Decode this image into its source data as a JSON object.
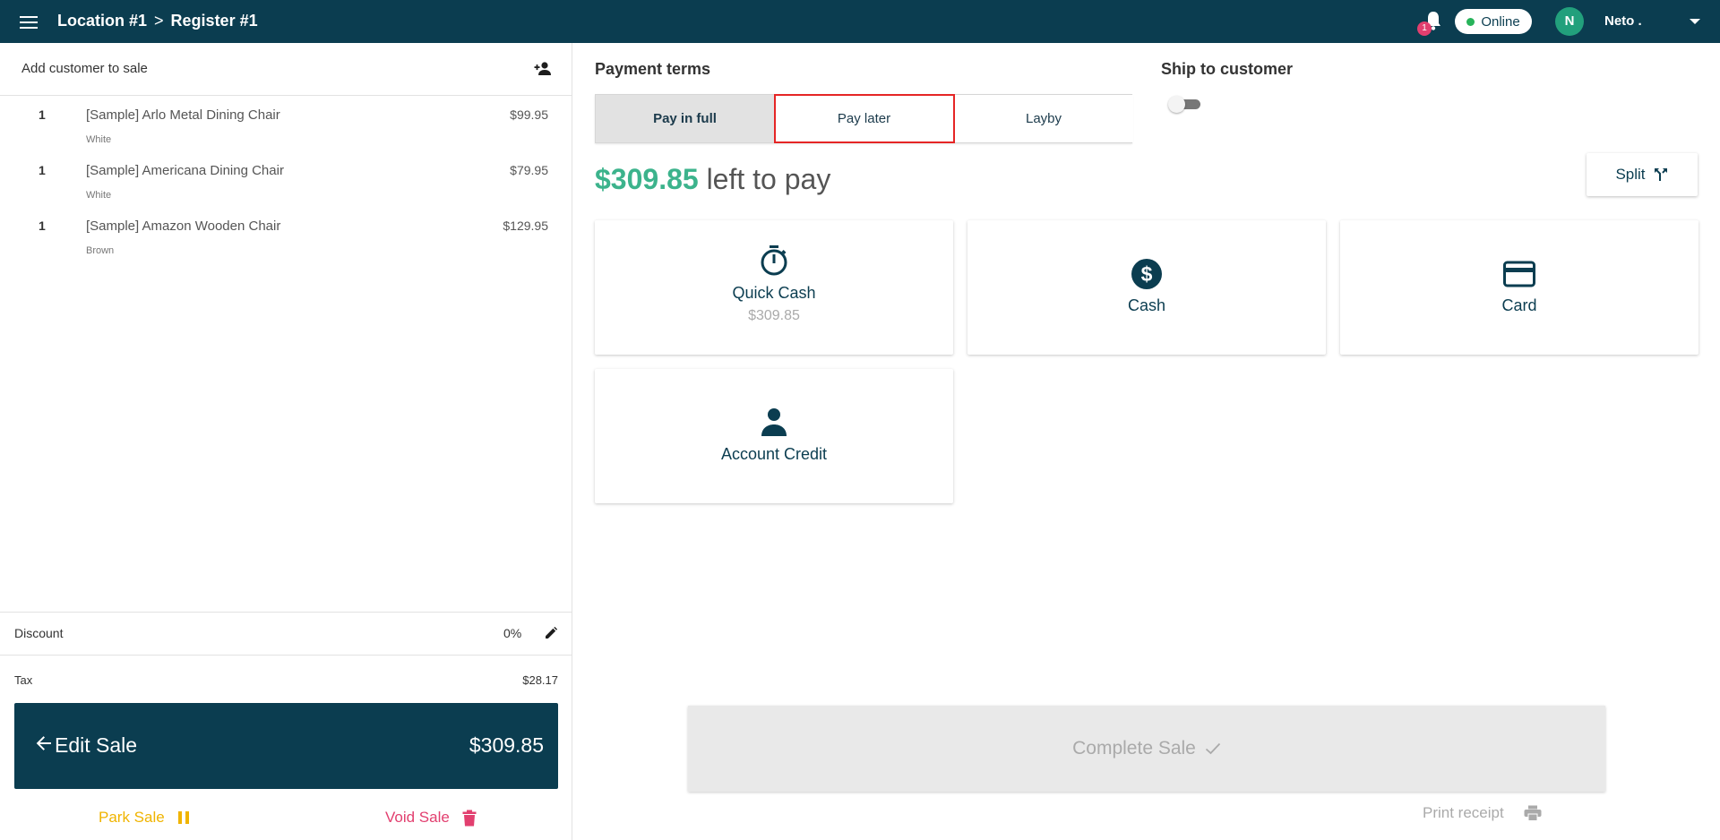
{
  "header": {
    "location": "Location #1",
    "separator": ">",
    "register": "Register #1",
    "notification_count": "1",
    "status": "Online",
    "user_initial": "N",
    "user_name": "Neto ."
  },
  "sidebar": {
    "add_customer_label": "Add customer to sale",
    "items": [
      {
        "qty": "1",
        "name": "[Sample] Arlo Metal Dining Chair",
        "variant": "White",
        "price": "$99.95"
      },
      {
        "qty": "1",
        "name": "[Sample] Americana Dining Chair",
        "variant": "White",
        "price": "$79.95"
      },
      {
        "qty": "1",
        "name": "[Sample] Amazon Wooden Chair",
        "variant": "Brown",
        "price": "$129.95"
      }
    ],
    "discount_label": "Discount",
    "discount_value": "0%",
    "tax_label": "Tax",
    "tax_value": "$28.17",
    "edit_sale_label": "Edit Sale",
    "total": "$309.85",
    "park_sale_label": "Park Sale",
    "void_sale_label": "Void Sale"
  },
  "payment": {
    "terms_title": "Payment terms",
    "terms": [
      {
        "label": "Pay in full",
        "state": "selected"
      },
      {
        "label": "Pay later",
        "state": "highlighted"
      },
      {
        "label": "Layby",
        "state": "default"
      }
    ],
    "ship_title": "Ship to customer",
    "ship_enabled": false,
    "left_amount": "$309.85",
    "left_text": "left to pay",
    "split_label": "Split",
    "methods": [
      {
        "title": "Quick Cash",
        "subtitle": "$309.85",
        "icon": "stopwatch-icon"
      },
      {
        "title": "Cash",
        "subtitle": "",
        "icon": "dollar-circle-icon"
      },
      {
        "title": "Card",
        "subtitle": "",
        "icon": "credit-card-icon"
      },
      {
        "title": "Account Credit",
        "subtitle": "",
        "icon": "person-icon"
      }
    ],
    "complete_sale_label": "Complete Sale",
    "print_receipt_label": "Print receipt"
  },
  "colors": {
    "primary": "#0b3d50",
    "accent_green": "#3cb38c",
    "park": "#f0b400",
    "void": "#e23f6f",
    "highlight_border": "#e52525",
    "online_dot": "#27b35a"
  }
}
